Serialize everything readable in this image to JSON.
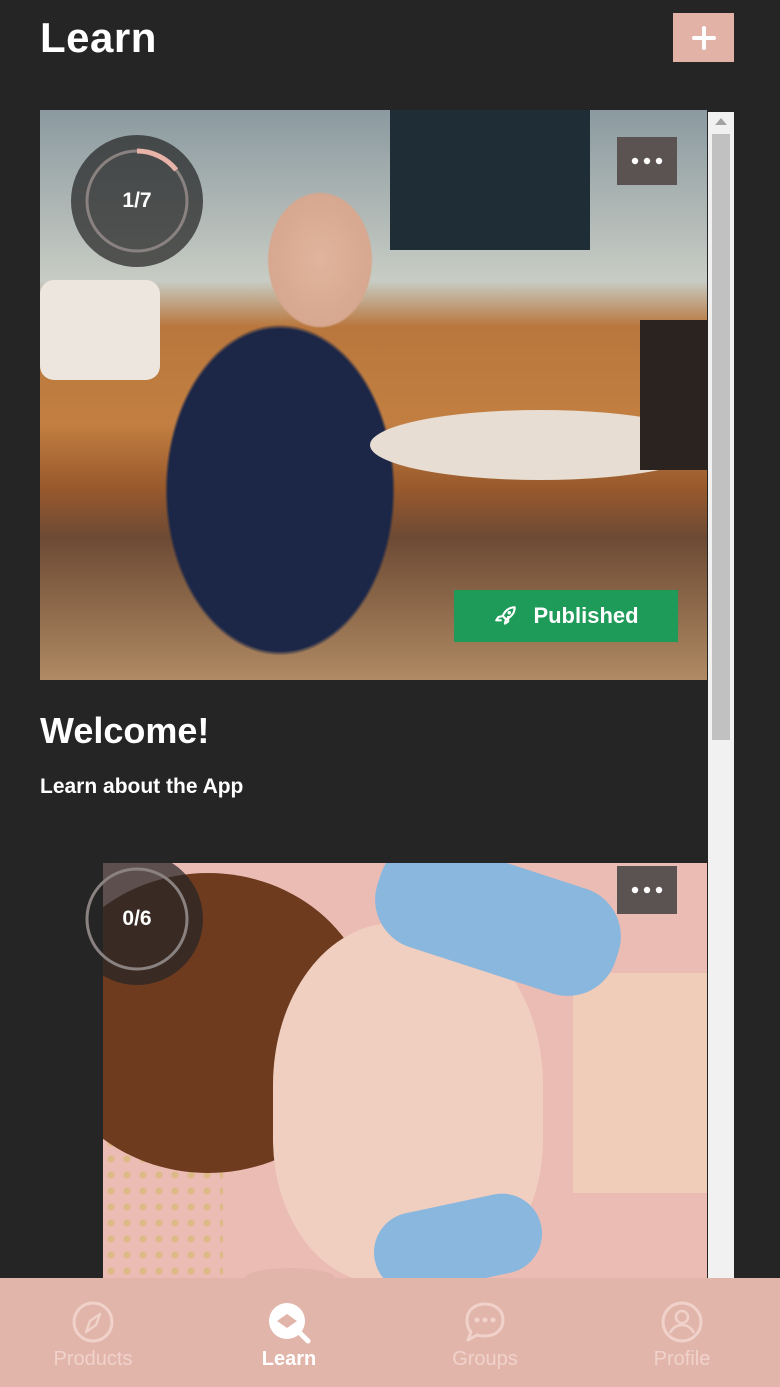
{
  "header": {
    "title": "Learn",
    "add_icon": "plus-icon"
  },
  "courses": [
    {
      "progress": "1/7",
      "progress_fraction": 0.143,
      "status": "Published",
      "status_icon": "rocket-icon",
      "title": "Welcome!",
      "subtitle": "Learn about the App",
      "more_icon": "ellipsis-icon"
    },
    {
      "progress": "0/6",
      "progress_fraction": 0,
      "more_icon": "ellipsis-icon"
    }
  ],
  "bottom_nav": {
    "items": [
      {
        "label": "Products",
        "icon": "compass-icon",
        "active": false
      },
      {
        "label": "Learn",
        "icon": "learn-search-icon",
        "active": true
      },
      {
        "label": "Groups",
        "icon": "chat-bubble-icon",
        "active": false
      },
      {
        "label": "Profile",
        "icon": "user-circle-icon",
        "active": false
      }
    ]
  },
  "colors": {
    "background": "#252525",
    "accent": "#e2b2a7",
    "published": "#1e9b58",
    "nav_background": "#e2b5aa"
  }
}
